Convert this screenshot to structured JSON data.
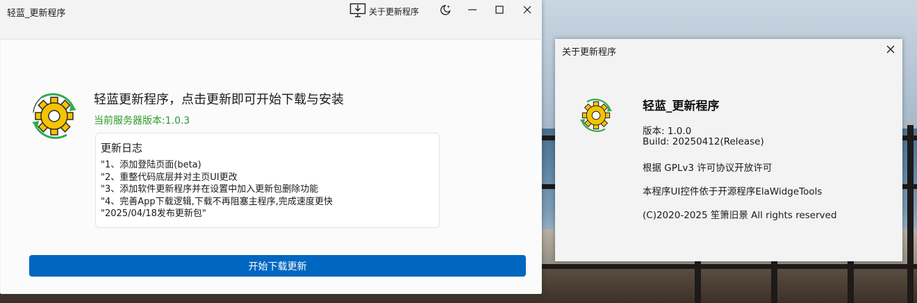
{
  "main_window": {
    "title": "轻蓝_更新程序",
    "about_button_label": "关于更新程序",
    "headline": "轻蓝更新程序，点击更新即可开始下载与安装",
    "server_version_text": "当前服务器版本:1.0.3",
    "changelog": {
      "title": "更新日志",
      "lines": [
        "\"1、添加登陆页面(beta)",
        "\"2、重整代码底层并对主页UI更改",
        "\"3、添加软件更新程序并在设置中加入更新包删除功能",
        "\"4、完善App下载逻辑,下载不再阻塞主程序,完成速度更快",
        "\"2025/04/18发布更新包\""
      ]
    },
    "start_button_label": "开始下载更新"
  },
  "about_dialog": {
    "title": "关于更新程序",
    "app_name": "轻蓝_更新程序",
    "version": "版本: 1.0.0",
    "build": "Build: 20250412(Release)",
    "license": "根据 GPLv3 许可协议开放许可",
    "dependency": "本程序UI控件依于开源程序ElaWidgeTools",
    "copyright": "(C)2020-2025 笙箫旧景 All rights reserved"
  },
  "colors": {
    "accent": "#0067c0",
    "server_version": "#2d9a2d",
    "gear_yellow": "#f5c400",
    "arrow_green": "#2eaa4e"
  },
  "icons": {
    "about": "monitor-download-icon",
    "theme": "moon-sparkle-icon",
    "minimize": "minimize-icon",
    "maximize": "maximize-icon",
    "close": "close-icon",
    "app": "gear-update-icon"
  }
}
